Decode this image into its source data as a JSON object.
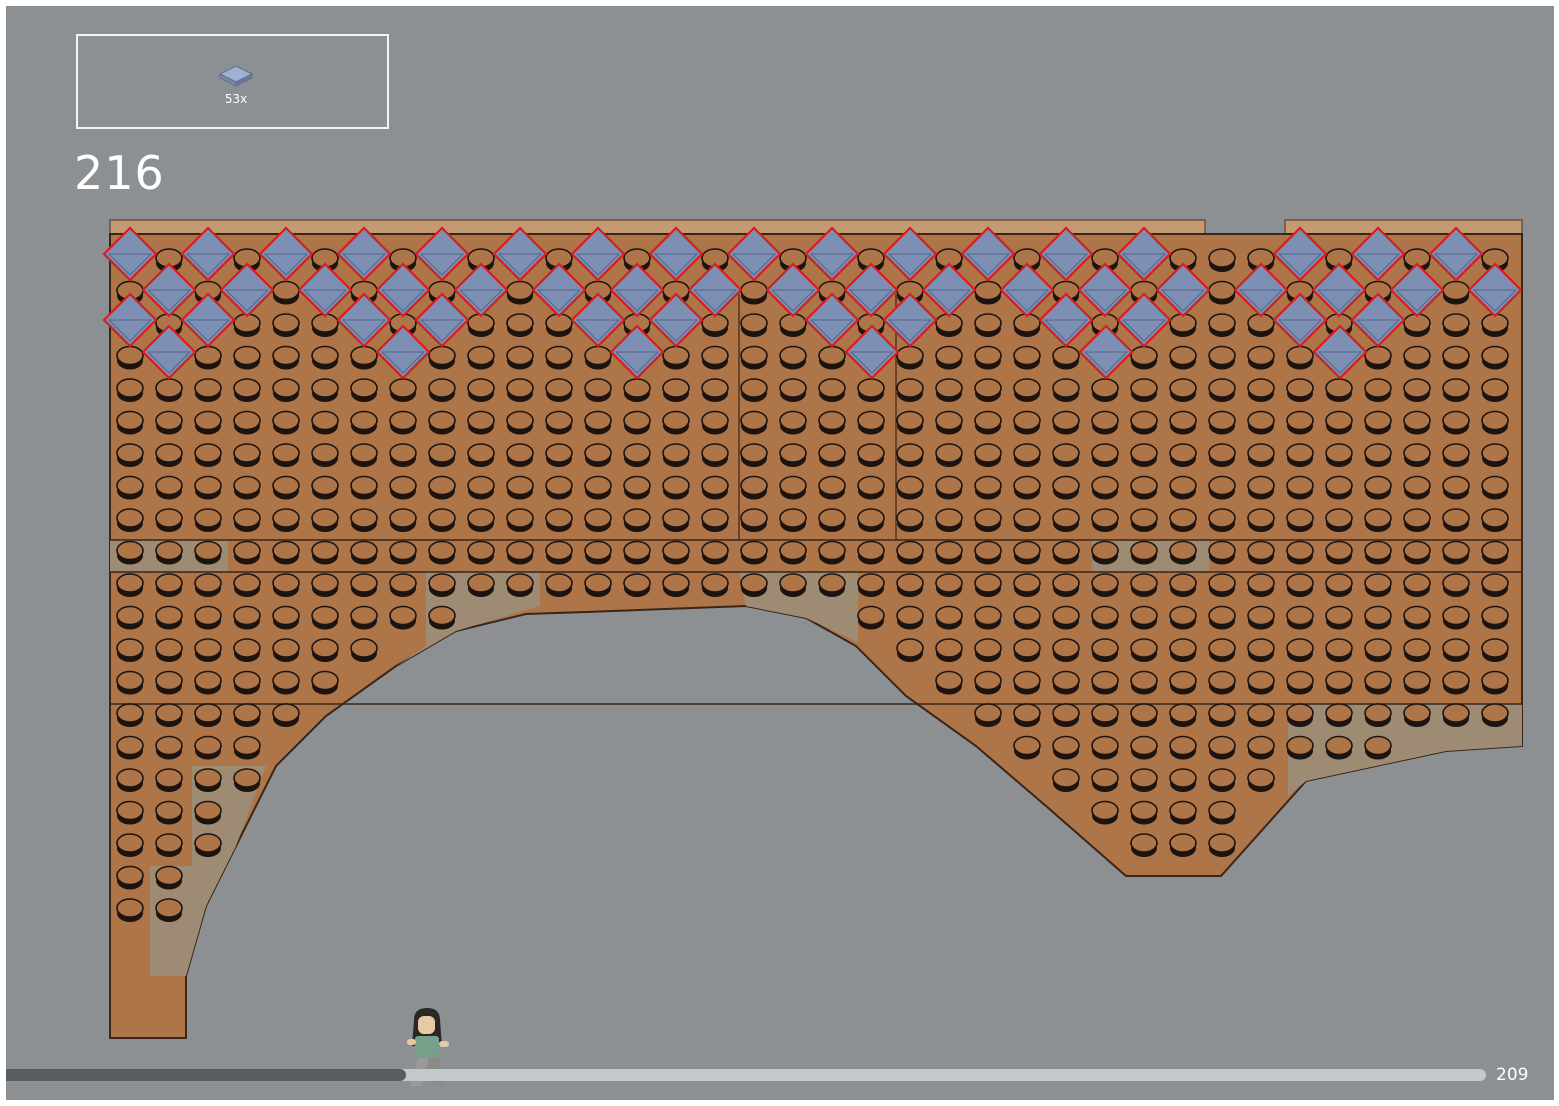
{
  "parts_list": {
    "items": [
      {
        "part": "tile-2x2-sand-blue",
        "icon": "tile-2x2-icon",
        "color": "#7d8fb3",
        "quantity": "53x"
      }
    ]
  },
  "step": {
    "number": "216"
  },
  "model": {
    "description_icon": "brick-wall-with-arches-icon",
    "base_color": "#ae7549",
    "new_tile_color": "#7d8fb3",
    "highlight_color": "#d81d1d",
    "slope_color": "#9d8c73"
  },
  "progress": {
    "fraction": 0.27,
    "track_color": "#c3c8cb",
    "fill_color": "#585d61"
  },
  "page": {
    "number": "209"
  }
}
